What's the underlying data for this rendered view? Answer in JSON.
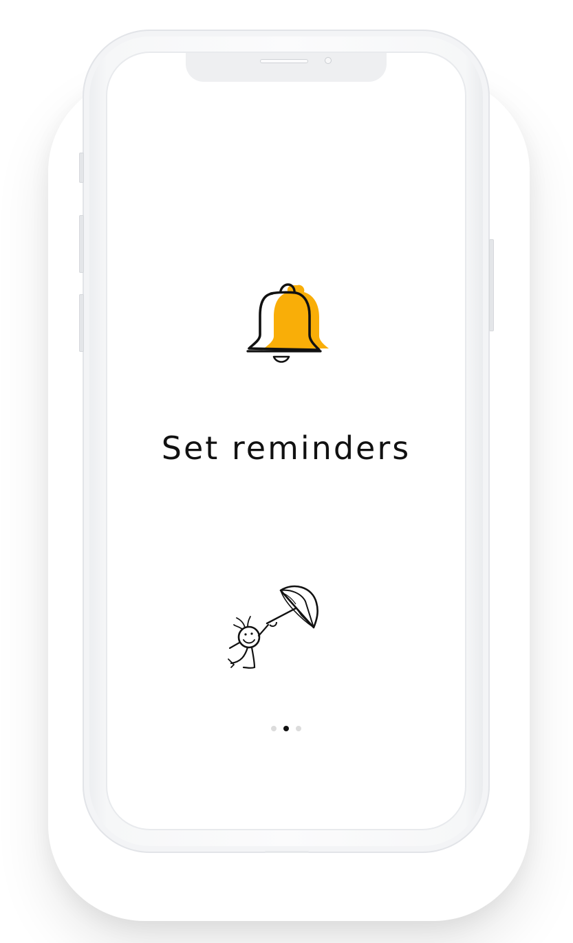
{
  "onboarding": {
    "title": "Set reminders",
    "illustration": "bell-icon",
    "mascot": "stick-figure-with-umbrella",
    "pagination": {
      "total_pages": 3,
      "current_page": 2
    },
    "colors": {
      "accent": "#F9AE08",
      "ink": "#111111",
      "dot_inactive": "#DCDCDC",
      "dot_active": "#111111"
    }
  }
}
